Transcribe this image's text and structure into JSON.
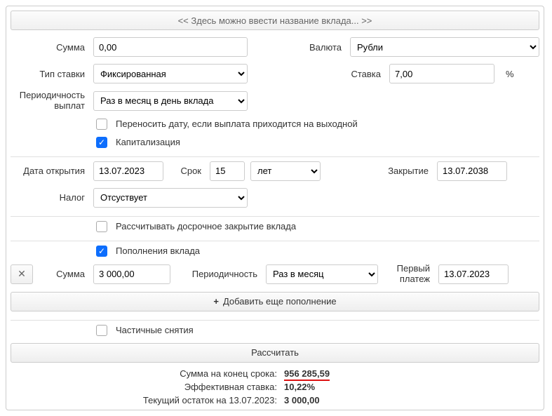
{
  "title_placeholder": "<< Здесь можно ввести название вклада... >>",
  "labels": {
    "sum": "Сумма",
    "currency": "Валюта",
    "rate_type": "Тип ставки",
    "rate": "Ставка",
    "percent_sign": "%",
    "payout_freq": "Периодичность выплат",
    "carry_date": "Переносить дату, если выплата приходится на выходной",
    "capitalization": "Капитализация",
    "open_date": "Дата открытия",
    "term": "Срок",
    "closing": "Закрытие",
    "tax": "Налог",
    "early_close": "Рассчитывать досрочное закрытие вклада",
    "topups": "Пополнения вклада",
    "topup_sum": "Сумма",
    "periodicity": "Периодичность",
    "first_payment": "Первый платеж",
    "add_topup": "Добавить еще пополнение",
    "partial_withdrawals": "Частичные снятия",
    "calculate": "Рассчитать"
  },
  "values": {
    "sum": "0,00",
    "currency": "Рубли",
    "rate_type": "Фиксированная",
    "rate": "7,00",
    "payout_freq": "Раз в месяц в день вклада",
    "open_date": "13.07.2023",
    "term_value": "15",
    "term_unit": "лет",
    "closing": "13.07.2038",
    "tax": "Отсуствует",
    "topup_sum": "3 000,00",
    "topup_periodicity": "Раз в месяц",
    "first_payment": "13.07.2023"
  },
  "checks": {
    "carry_date": false,
    "capitalization": true,
    "early_close": false,
    "topups": true,
    "partial_withdrawals": false
  },
  "results": {
    "end_sum_label": "Сумма на конец срока:",
    "end_sum_value": "956 285,59",
    "eff_rate_label": "Эффективная ставка:",
    "eff_rate_value": "10,22%",
    "balance_label": "Текущий остаток на 13.07.2023:",
    "balance_value": "3 000,00"
  }
}
